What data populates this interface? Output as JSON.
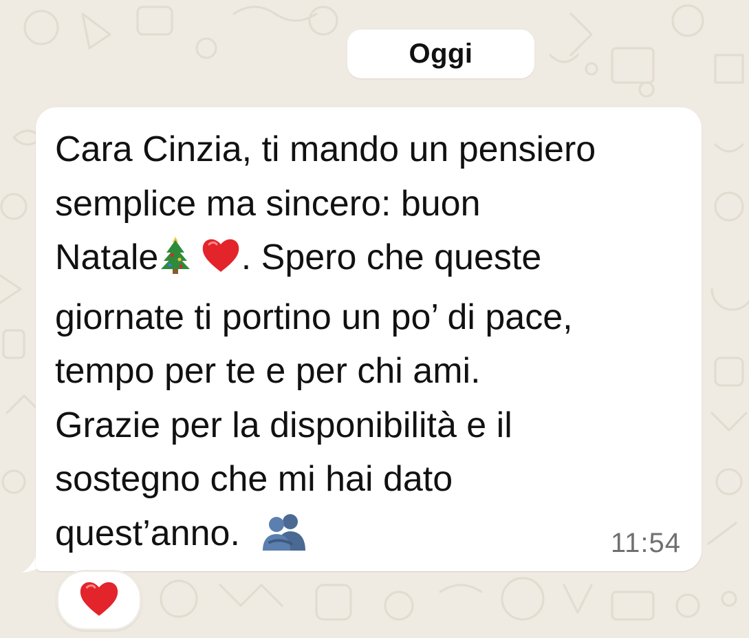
{
  "chat": {
    "date_label": "Oggi",
    "message": {
      "line1": "Cara Cinzia, ti mando un pensiero",
      "line2": "semplice ma sincero: buon",
      "line3_a": "Natale",
      "line3_b": ". Spero che queste",
      "line4": "giornate ti portino un po’ di pace,",
      "line5": "tempo per te e per chi ami.",
      "line6": "Grazie per la disponibilità e il",
      "line7": "sostegno che mi hai dato",
      "line8": "quest’anno.",
      "inline_emojis": [
        "christmas-tree-icon",
        "red-heart-icon",
        "people-hugging-icon"
      ],
      "time": "11:54"
    },
    "reaction": {
      "emoji": "red-heart-icon"
    }
  },
  "colors": {
    "wallpaper": "#efeae2",
    "bubble": "#ffffff",
    "text": "#111111",
    "timestamp": "#707070",
    "heart": "#e3242b",
    "tree": "#2e8b3a",
    "hug": "#3d5a80"
  }
}
